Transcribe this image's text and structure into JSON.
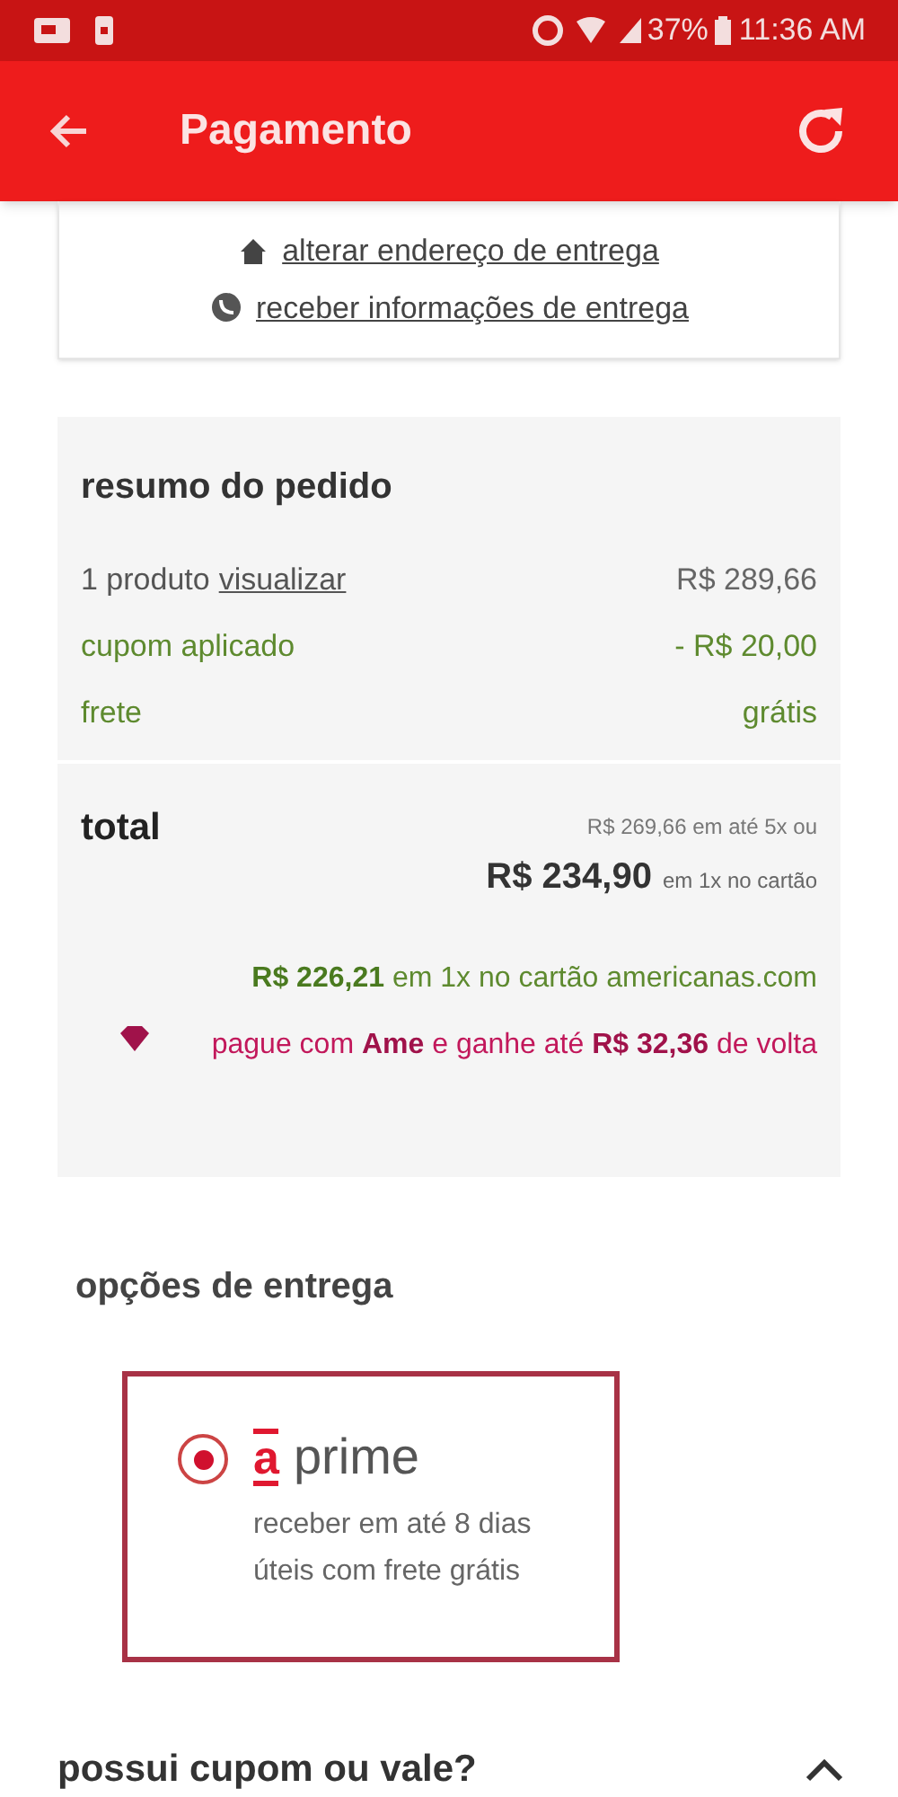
{
  "status_bar": {
    "battery": "37%",
    "time": "11:36 AM"
  },
  "app_bar": {
    "title": "Pagamento"
  },
  "delivery_links": [
    {
      "kind": "home",
      "label": "alterar endereço de entrega"
    },
    {
      "kind": "whatsapp",
      "label": "receber informações de entrega"
    }
  ],
  "order_summary": {
    "title": "resumo do pedido",
    "rows": [
      {
        "kind": "plain",
        "label": "1 produto",
        "link": "visualizar",
        "value": "R$ 289,66"
      },
      {
        "kind": "discount",
        "label": "cupom aplicado",
        "value": "- R$ 20,00"
      },
      {
        "kind": "shipping",
        "label": "frete",
        "value": "grátis"
      }
    ],
    "total_label": "total",
    "installments": "R$ 269,66 em até 5x ou",
    "total_value": "R$ 234,90",
    "total_note": "em 1x no cartão",
    "card_offer": "**R$ 226,21** em 1x no cartão americanas.com",
    "ame_offer": "pague com **Ame** e ganhe até **R$ 32,36** de volta"
  },
  "delivery_options": {
    "title": "opções de entrega",
    "options": [
      {
        "logo_mark": "a",
        "name": "prime",
        "description": "receber em até 8 dias úteis com frete grátis",
        "selected": true
      }
    ]
  },
  "coupon": {
    "title": "possui cupom ou vale?",
    "expanded": true
  }
}
